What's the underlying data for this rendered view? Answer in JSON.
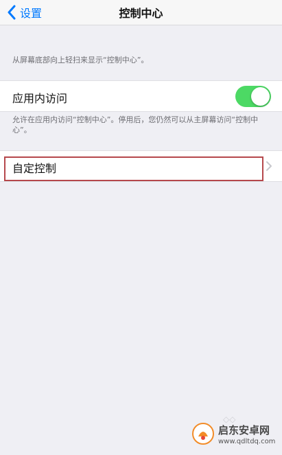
{
  "navbar": {
    "back_label": "设置",
    "title": "控制中心"
  },
  "notes": {
    "top": "从屏幕底部向上轻扫来显示“控制中心”。",
    "mid": "允许在应用内访问“控制中心”。停用后，您仍然可以从主屏幕访问“控制中心”。"
  },
  "cells": {
    "inapp": {
      "label": "应用内访问",
      "toggle_on": true
    },
    "custom": {
      "label": "自定控制"
    }
  },
  "watermark": {
    "title": "启东安卓网",
    "url": "www.qdltdq.com"
  },
  "colors": {
    "accent": "#007aff",
    "toggle_on": "#4cd964",
    "highlight": "#b5474b",
    "background": "#efeff4"
  },
  "icons": {
    "back": "chevron-left-icon",
    "disclosure": "chevron-right-icon",
    "logo": "watermark-logo-icon"
  }
}
